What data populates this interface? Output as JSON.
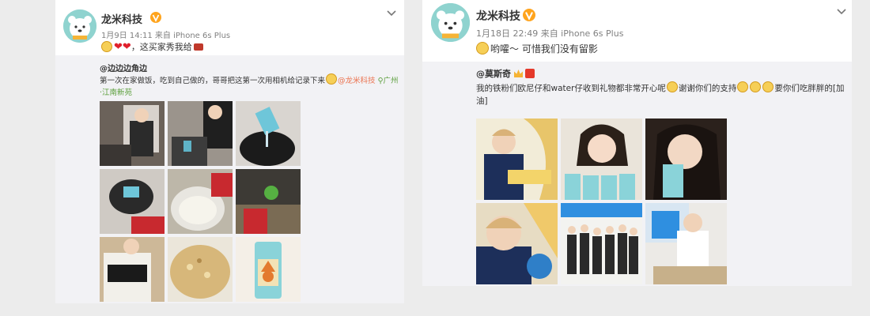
{
  "posts": [
    {
      "author": "龙米科技",
      "meta": "1月9日 14:11 来自 iPhone 6s Plus",
      "text": "，这买家秀我给",
      "repost": {
        "user": "@边边边角边",
        "text": "第一次在家做饭，吃到自己做的，哥哥把这第一次用相机给记录下来",
        "mention": "@龙米科技",
        "location": "广州·江南新苑"
      }
    },
    {
      "author": "龙米科技",
      "meta": "1月18日 22:49 来自 iPhone 6s Plus",
      "text": "哟嚯～ 可惜我们没有留影",
      "repost": {
        "user": "@莫斯奇",
        "text_a": "我的铁粉们欧尼仔和water仔收到礼物都非常开心呢",
        "text_b": "谢谢你们的支持",
        "text_c": "要你们吃胖胖的[加油]"
      }
    }
  ],
  "icons": {
    "avatar": "polar-bear-avatar-icon",
    "verified": "verified-v-icon",
    "more": "chevron-down-icon",
    "location": "location-pin-icon",
    "vip_crown": "crown-icon"
  },
  "colors": {
    "link": "#eb7350",
    "verified": "#ffa41d",
    "accent_blue": "#2f8fe0"
  }
}
